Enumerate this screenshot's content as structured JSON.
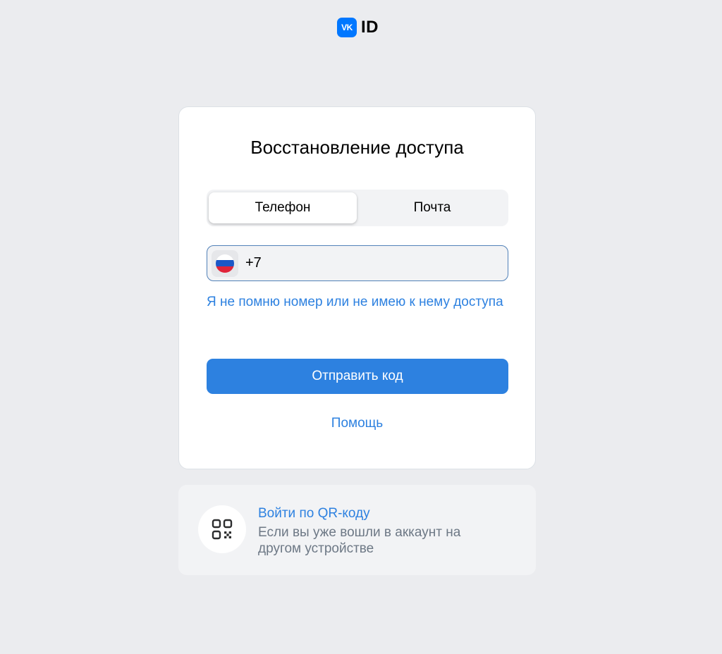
{
  "header": {
    "logo_mark": "VK",
    "logo_text": "ID"
  },
  "card": {
    "title": "Восстановление доступа",
    "tabs": [
      {
        "label": "Телефон",
        "active": true
      },
      {
        "label": "Почта",
        "active": false
      }
    ],
    "phone": {
      "country_flag": "russia-flag-icon",
      "value": "+7"
    },
    "forgot_link": "Я не помню номер или не имею к нему доступа",
    "send_button": "Отправить код",
    "help_link": "Помощь"
  },
  "qr": {
    "icon": "qr-code-icon",
    "title": "Войти по QR-коду",
    "subtitle": "Если вы уже вошли в аккаунт на другом устройстве"
  },
  "colors": {
    "background": "#ebecef",
    "accent": "#2d81e0",
    "vk_blue": "#0077ff",
    "flag_white": "#ffffff",
    "flag_blue": "#1c57c7",
    "flag_red": "#e0243a"
  }
}
